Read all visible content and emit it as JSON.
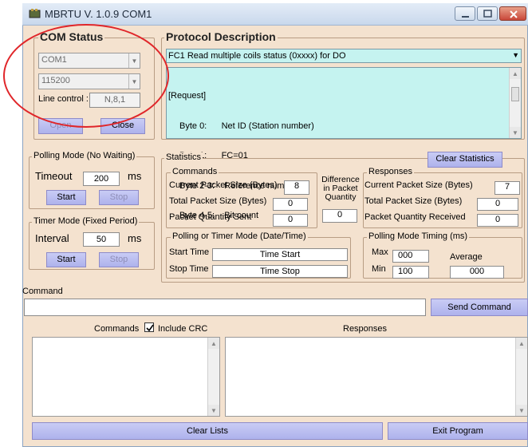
{
  "window": {
    "title": "MBRTU V. 1.0.9 COM1"
  },
  "com_status": {
    "title": "COM Status",
    "port": "COM1",
    "baud": "115200",
    "line_control_label": "Line control :",
    "line_control_value": "N,8,1",
    "open_label": "Open",
    "close_label": "Close"
  },
  "protocol": {
    "title": "Protocol Description",
    "selected": "FC1  Read multiple coils status (0xxxx)  for DO",
    "description": [
      "[Request]",
      "Byte 0:      Net ID (Station number)",
      "Byte 1:      FC=01",
      "Byte 2-3:    Reference number",
      "Byte 4-5:    Bit count"
    ]
  },
  "polling": {
    "title": "Polling Mode (No Waiting)",
    "timeout_label": "Timeout",
    "timeout_value": "200",
    "unit": "ms",
    "start": "Start",
    "stop": "Stop"
  },
  "timer": {
    "title": "Timer Mode (Fixed Period)",
    "interval_label": "Interval",
    "interval_value": "50",
    "unit": "ms",
    "start": "Start",
    "stop": "Stop"
  },
  "statistics": {
    "title": "Statistics",
    "clear": "Clear Statistics",
    "commands": {
      "title": "Commands",
      "current_label": "Current Packet Size (Bytes)",
      "current_value": "8",
      "total_label": "Total Packet Size (Bytes)",
      "total_value": "0",
      "qty_label": "Packet Quantity Sent",
      "qty_value": "0"
    },
    "difference": {
      "line1": "Difference",
      "line2": "in Packet",
      "line3": "Quantity",
      "value": "0"
    },
    "responses": {
      "title": "Responses",
      "current_label": "Current Packet Size (Bytes)",
      "current_value": "7",
      "total_label": "Total Packet Size (Bytes)",
      "total_value": "0",
      "qty_label": "Packet Quantity Received",
      "qty_value": "0"
    },
    "time": {
      "title": "Polling  or Timer Mode  (Date/Time)",
      "start_label": "Start Time",
      "start_value": "Time Start",
      "stop_label": "Stop Time",
      "stop_value": "Time Stop"
    },
    "timing": {
      "title": "Polling Mode Timing (ms)",
      "max_label": "Max",
      "max_value": "000",
      "min_label": "Min",
      "min_value": "100",
      "avg_label": "Average",
      "avg_value": "000"
    }
  },
  "command": {
    "label": "Command",
    "value": "",
    "send": "Send Command"
  },
  "lists": {
    "commands_label": "Commands",
    "include_crc": "Include CRC",
    "responses_label": "Responses",
    "clear": "Clear Lists",
    "exit": "Exit Program"
  }
}
